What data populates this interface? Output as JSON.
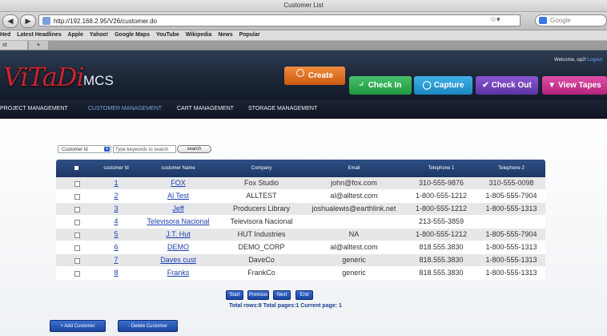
{
  "browser": {
    "window_title": "Customer List",
    "url": "http://192.168.2.95/V26/customer.do",
    "search_placeholder": "Google",
    "bookmarks": [
      "Hed",
      "Latest Headlines",
      "Apple",
      "Yahoo!",
      "Google Maps",
      "YouTube",
      "Wikipedia",
      "News",
      "Popular"
    ],
    "tab_label": "st",
    "new_tab": "+",
    "back_icon": "back-arrow-icon",
    "forward_icon": "forward-arrow-icon"
  },
  "app": {
    "logo_main": "ViTaDi",
    "logo_sub": "MCS",
    "welcome_text": "Welcome, op2!",
    "logout_label": "Logout",
    "brand_red": "#c8252e",
    "header_bg": "#1c2637",
    "buttons": {
      "create": "Create",
      "check_in": "Check In",
      "capture": "Capture",
      "check_out": "Check Out",
      "view_tapes": "View Tapes"
    },
    "menu": [
      "PROJECT MANAGEMENT",
      "CUSTOMER MANAGEMENT",
      "CART MANAGEMENT",
      "STORAGE MANAGEMENT"
    ]
  },
  "search": {
    "field_select": "Customer Id",
    "keyword_placeholder": "Type keywords to search",
    "search_label": "search"
  },
  "table": {
    "headers": [
      "customer Id",
      "customer Name",
      "Company",
      "Email",
      "Telephone 1",
      "Telephone 2"
    ],
    "rows": [
      {
        "id": "1",
        "name": "FOX",
        "company": "Fox Studio",
        "email": "john@fox.com",
        "tel1": "310-555-9876",
        "tel2": "310-555-0098"
      },
      {
        "id": "2",
        "name": "Al Test",
        "company": "ALLTEST",
        "email": "al@alltest.com",
        "tel1": "1-800-555-1212",
        "tel2": "1-805-555-7904"
      },
      {
        "id": "3",
        "name": "Jeff",
        "company": "Producers Library",
        "email": "joshualewis@earthlink.net",
        "tel1": "1-800-555-1212",
        "tel2": "1-800-555-1313"
      },
      {
        "id": "4",
        "name": "Televisora Nacional",
        "company": "Televisora Nacional",
        "email": "",
        "tel1": "213-555-3859",
        "tel2": ""
      },
      {
        "id": "5",
        "name": "J.T. Hut",
        "company": "HUT Industries",
        "email": "NA",
        "tel1": "1-800-555-1212",
        "tel2": "1-805-555-7904"
      },
      {
        "id": "6",
        "name": "DEMO",
        "company": "DEMO_CORP",
        "email": "al@alltest.com",
        "tel1": "818.555.3830",
        "tel2": "1-800-555-1313"
      },
      {
        "id": "7",
        "name": "Daves cust",
        "company": "DaveCo",
        "email": "generic",
        "tel1": "818.555.3830",
        "tel2": "1-800-555-1313"
      },
      {
        "id": "8",
        "name": "Franks",
        "company": "FrankCo",
        "email": "generic",
        "tel1": "818.555.3830",
        "tel2": "1-800-555-1313"
      }
    ]
  },
  "pager": {
    "start": "Start",
    "previous": "Previous",
    "next": "Next",
    "end": "End",
    "summary": "Total rows:8   Total pages:1   Current page: 1"
  },
  "actions": {
    "add": "+ Add Customer",
    "delete": "- Delete Customer"
  }
}
